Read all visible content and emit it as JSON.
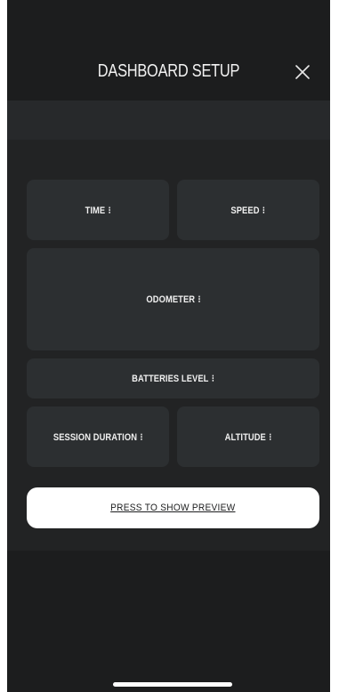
{
  "header": {
    "title": "DASHBOARD SETUP"
  },
  "tiles": {
    "time": "TIME",
    "speed": "SPEED",
    "odometer": "ODOMETER",
    "batteries_level": "BATTERIES LEVEL",
    "session_duration": "SESSION DURATION",
    "altitude": "ALTITUDE",
    "menu_glyph": "⁝"
  },
  "preview_button": {
    "label": "PRESS TO SHOW PREVIEW"
  },
  "icons": {
    "close": "close-icon",
    "more": "vertical-dots-icon"
  },
  "colors": {
    "background": "#1c1d1e",
    "panel": "#222324",
    "tile": "#2c2f31",
    "text": "#f0f0f0",
    "button": "#ffffff"
  }
}
